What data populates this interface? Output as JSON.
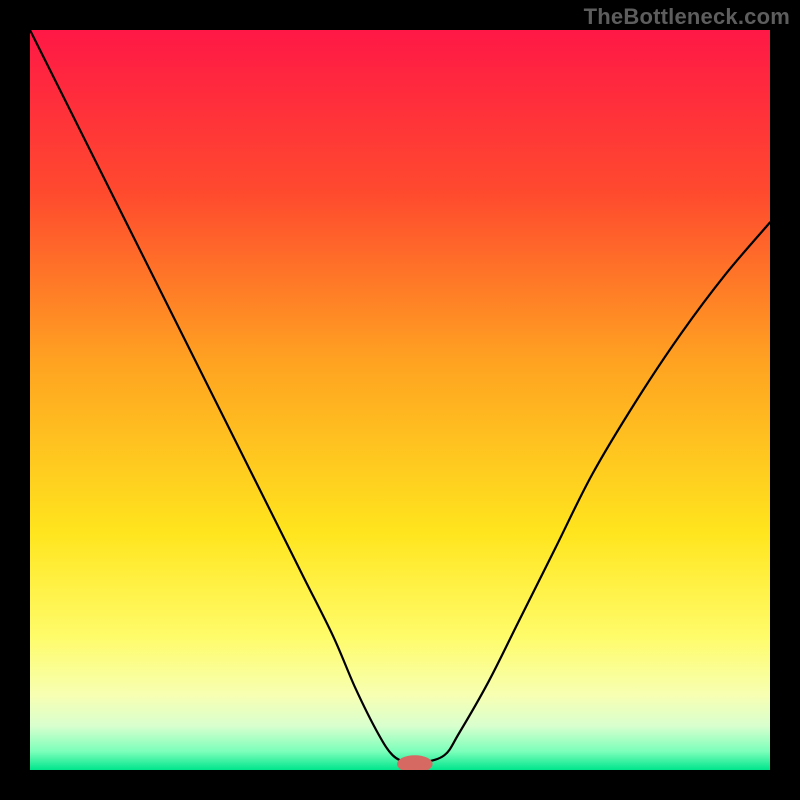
{
  "watermark": "TheBottleneck.com",
  "chart_data": {
    "type": "line",
    "title": "",
    "xlabel": "",
    "ylabel": "",
    "xlim": [
      0,
      100
    ],
    "ylim": [
      0,
      100
    ],
    "grid": false,
    "legend": false,
    "background_gradient": {
      "stops": [
        {
          "offset": 0.0,
          "color": "#ff1846"
        },
        {
          "offset": 0.22,
          "color": "#ff4a2e"
        },
        {
          "offset": 0.45,
          "color": "#ffa321"
        },
        {
          "offset": 0.68,
          "color": "#ffe51e"
        },
        {
          "offset": 0.82,
          "color": "#fffc6a"
        },
        {
          "offset": 0.9,
          "color": "#f7ffb3"
        },
        {
          "offset": 0.94,
          "color": "#d9ffce"
        },
        {
          "offset": 0.975,
          "color": "#7bffba"
        },
        {
          "offset": 1.0,
          "color": "#00e58c"
        }
      ]
    },
    "series": [
      {
        "name": "bottleneck-curve",
        "color": "#000000",
        "stroke_width": 2.2,
        "x": [
          0,
          6,
          12,
          18,
          23,
          28,
          33,
          37,
          41,
          44,
          47,
          49,
          51,
          53,
          56,
          58,
          62,
          66,
          71,
          76,
          82,
          88,
          94,
          100
        ],
        "values": [
          100,
          88,
          76,
          64,
          54,
          44,
          34,
          26,
          18,
          11,
          5,
          2,
          1,
          1,
          2,
          5,
          12,
          20,
          30,
          40,
          50,
          59,
          67,
          74
        ]
      }
    ],
    "marker": {
      "name": "optimum-marker",
      "x": 52,
      "y": 0.8,
      "rx": 2.4,
      "ry": 1.2,
      "color": "#d66a63"
    }
  }
}
